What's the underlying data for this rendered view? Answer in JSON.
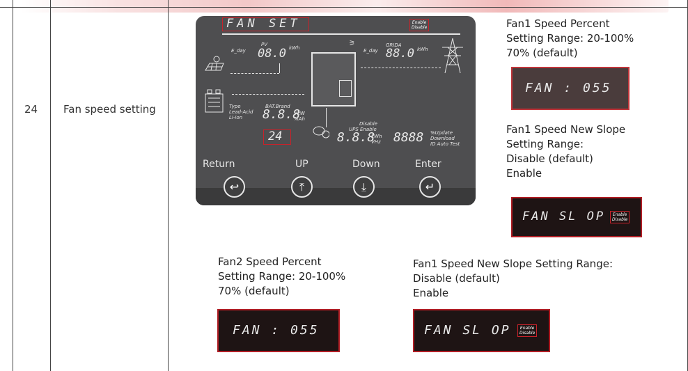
{
  "row": {
    "number": "24",
    "title": "Fan speed setting"
  },
  "panel": {
    "title_display": "FAN SET",
    "title_badge": [
      "Enable",
      "Disable"
    ],
    "pv": {
      "label_e_day": "E_day",
      "label_pv": "PV",
      "value": "08.0",
      "unit": "kWh"
    },
    "grid": {
      "label_e_day": "E_day",
      "label_grid": "GRIDA",
      "value": "88.0",
      "unit": "kWh"
    },
    "battery": {
      "type_lines": [
        "Type",
        "Lead-Acid",
        "Li-ion"
      ],
      "brand": "BAT.Brand",
      "value": "8.8.8",
      "units": [
        "VkW",
        "%Ah"
      ]
    },
    "code_value": "24",
    "ups": {
      "disable": "Disable",
      "ups_enable": "UPS Enable",
      "value": "8.8.8",
      "units": [
        "kWh",
        "VHz"
      ]
    },
    "right_digits": {
      "value": "8888",
      "labels": [
        "%Update",
        "Download",
        "ID Auto Test"
      ]
    },
    "buttons": [
      {
        "label": "Return",
        "glyph": "↩"
      },
      {
        "label": "UP",
        "glyph": "⤒"
      },
      {
        "label": "Down",
        "glyph": "⤓"
      },
      {
        "label": "Enter",
        "glyph": "↵"
      }
    ]
  },
  "notes": {
    "fan1_percent": "Fan1 Speed Percent\nSetting Range: 20-100%\n70% (default)",
    "fan1_percent_display": "FAN : 055",
    "fan1_slope_right": "Fan1 Speed New Slope\nSetting Range:\nDisable (default)\nEnable",
    "fan1_slope_right_display": "FAN SL OP",
    "fan1_slope_right_badge": [
      "Enable",
      "Disable"
    ],
    "fan2_percent": "Fan2 Speed Percent\nSetting Range: 20-100%\n70% (default)",
    "fan2_percent_display": "FAN : 055",
    "fan1_slope_bottom": "Fan1 Speed New Slope Setting Range:\nDisable (default)\nEnable",
    "fan1_slope_bottom_display": "FAN SL OP",
    "fan1_slope_bottom_badge": [
      "Enable",
      "Disable"
    ]
  }
}
